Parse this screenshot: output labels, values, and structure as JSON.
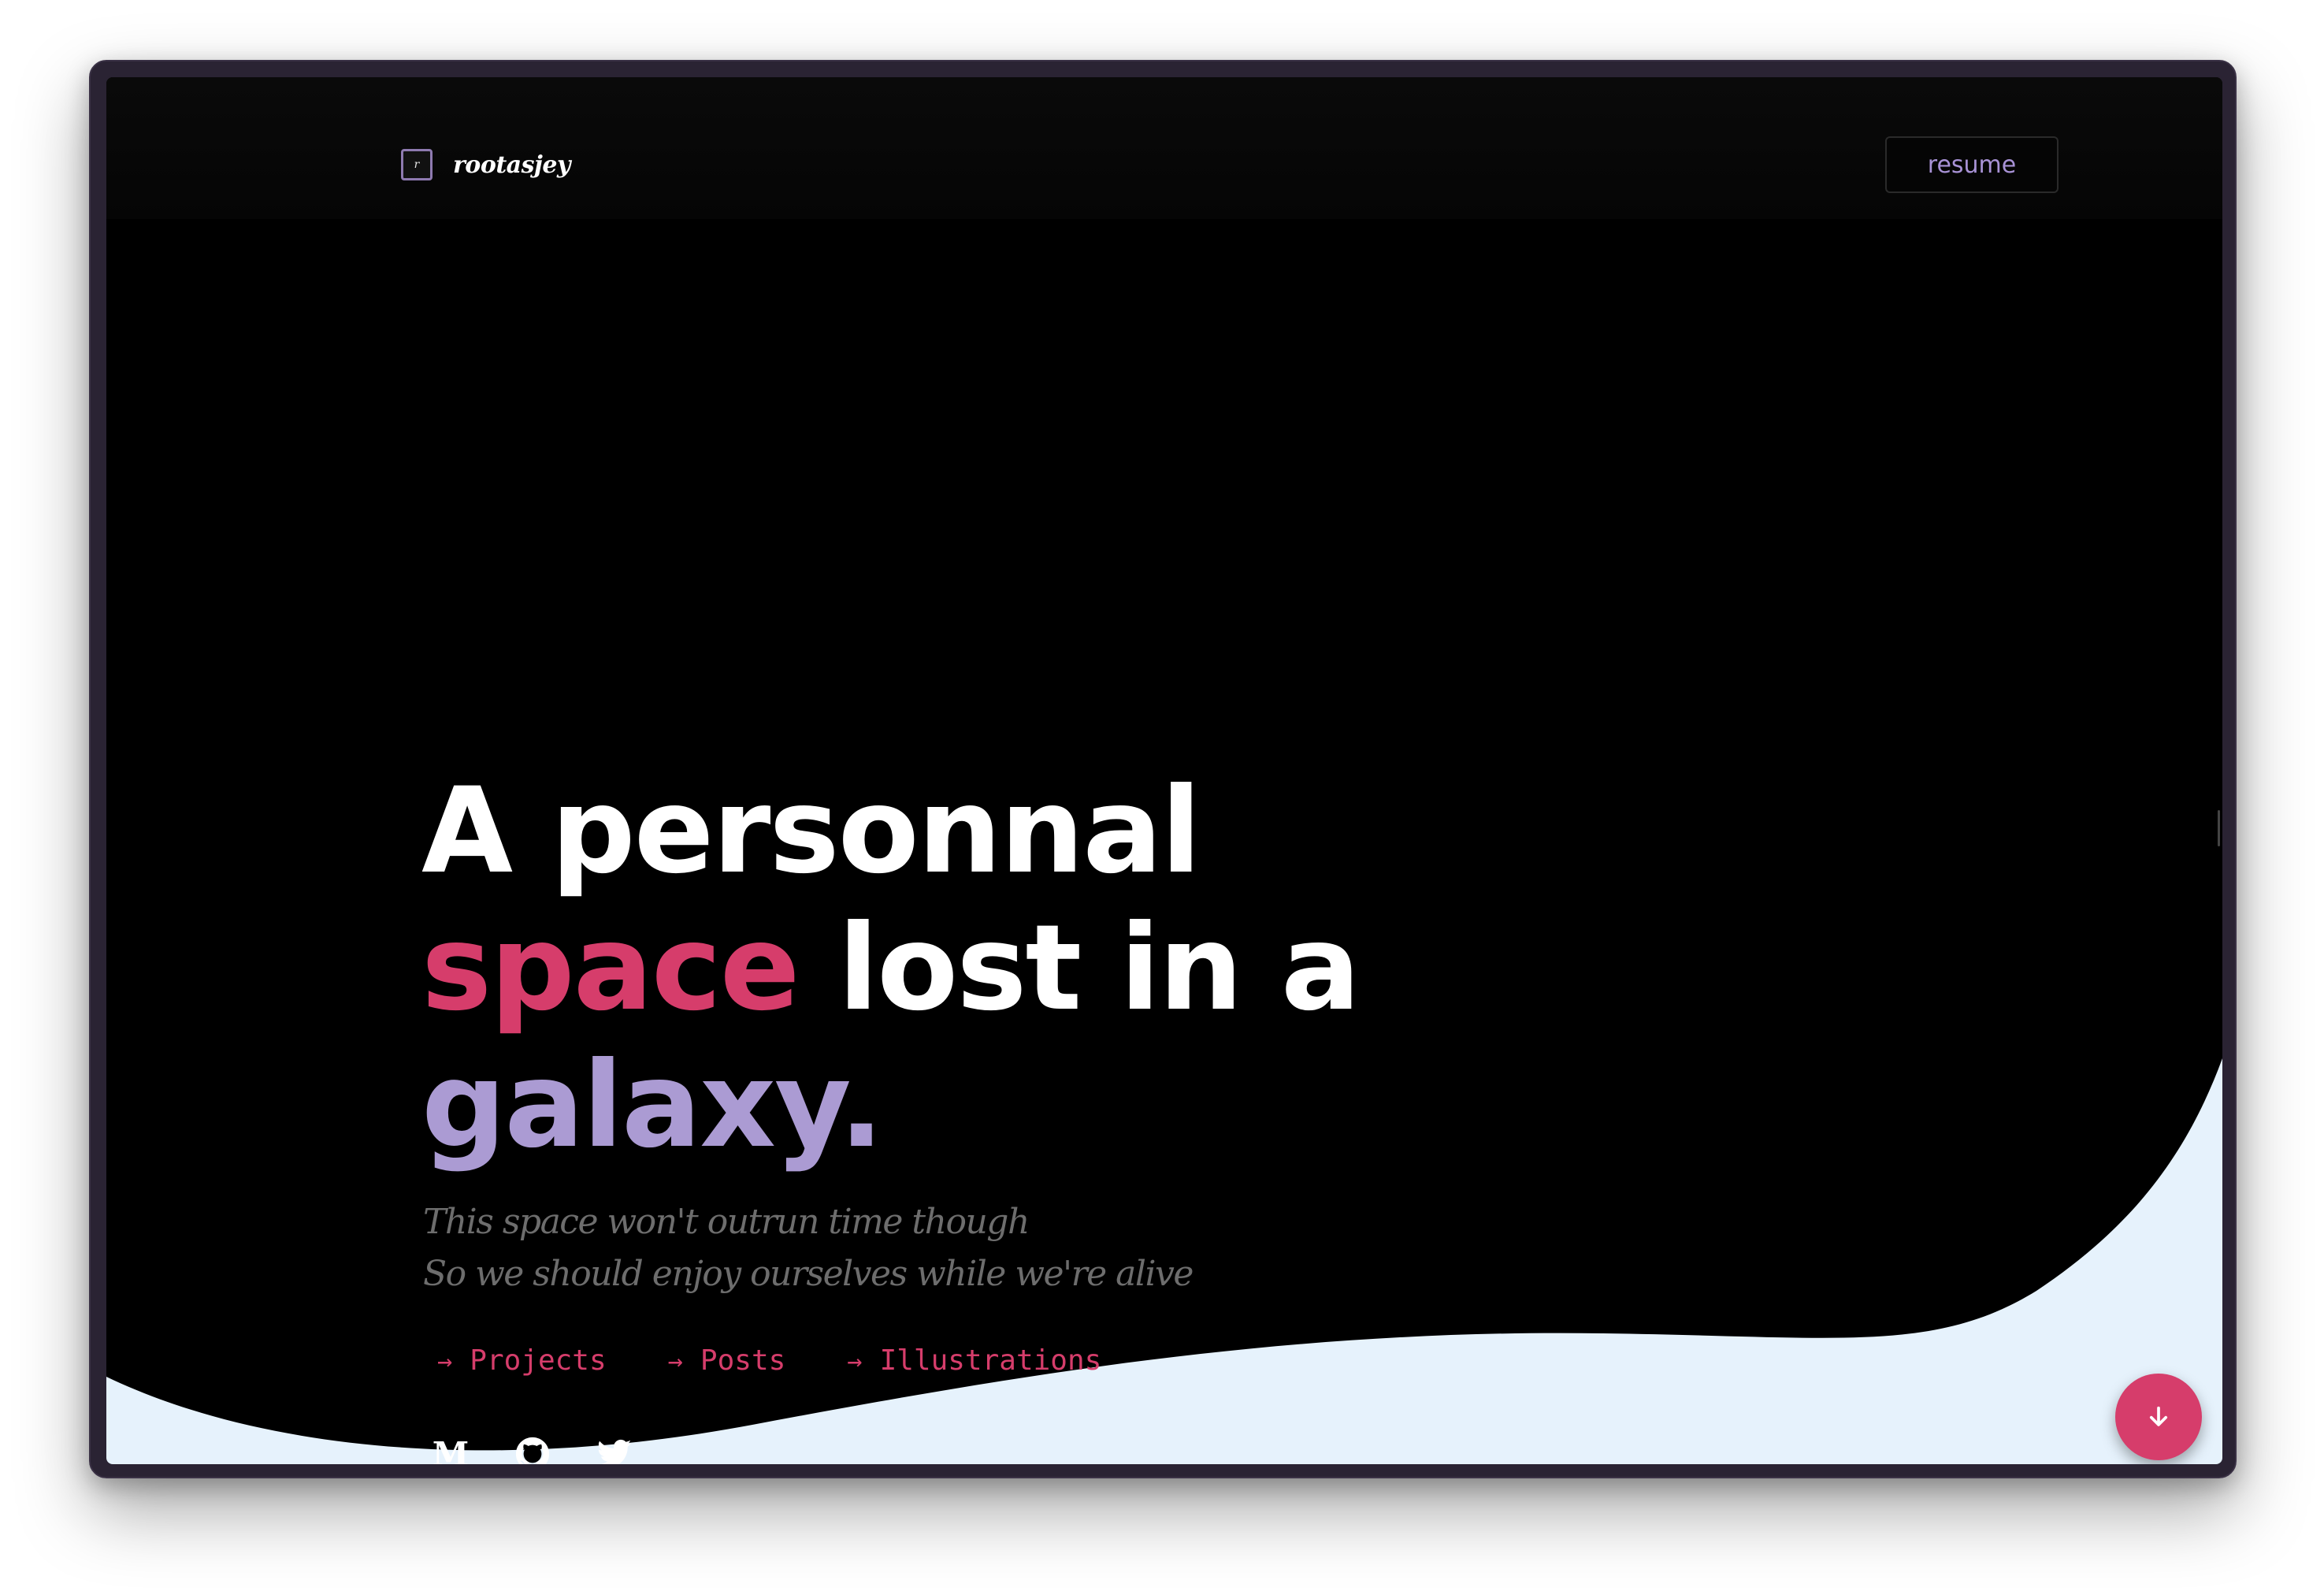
{
  "brand": {
    "logo_mark": "r",
    "name": "rootasjey",
    "logo_icon": "r-monogram-icon"
  },
  "header": {
    "resume_label": "resume"
  },
  "hero": {
    "line1": "A personnal",
    "line2_accent": "space",
    "line2_rest": " lost in a",
    "line3": "galaxy.",
    "tagline_line1": "This space won't outrun time though",
    "tagline_line2": "So we should enjoy ourselves while we're alive"
  },
  "nav": {
    "links": [
      {
        "label": "Projects",
        "icon": "arrow-right-icon"
      },
      {
        "label": "Posts",
        "icon": "arrow-right-icon"
      },
      {
        "label": "Illustrations",
        "icon": "arrow-right-icon"
      }
    ]
  },
  "socials": [
    {
      "name": "medium",
      "icon": "medium-icon",
      "glyph": "M"
    },
    {
      "name": "github",
      "icon": "github-icon"
    },
    {
      "name": "twitter",
      "icon": "twitter-icon"
    }
  ],
  "fab": {
    "icon": "arrow-down-icon"
  },
  "colors": {
    "background": "#000000",
    "accent_pink": "#d63d6b",
    "accent_lavender": "#ab9bd3",
    "wave": "#e6f2fc",
    "tagline": "#6d6d6d"
  }
}
